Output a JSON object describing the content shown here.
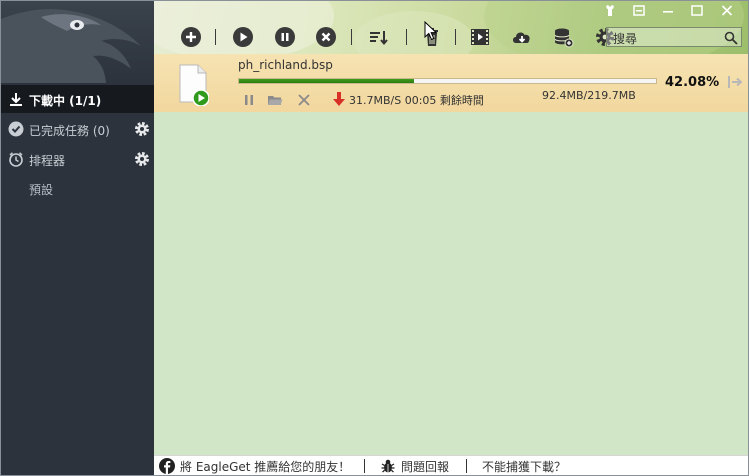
{
  "sidebar": {
    "items": [
      {
        "label": "下載中 (1/1)"
      },
      {
        "label": "已完成任務 (0)"
      },
      {
        "label": "排程器"
      }
    ],
    "sub_item": "預設"
  },
  "toolbar": {
    "search_placeholder": "搜尋"
  },
  "download": {
    "filename": "ph_richland.bsp",
    "progress_percent": "42.08%",
    "progress_fraction": 0.4208,
    "speed_text": "31.7MB/S 00:05 剩餘時間",
    "size_text": "92.4MB/219.7MB"
  },
  "statusbar": {
    "recommend": "將 EagleGet 推薦給您的朋友！",
    "feedback": "問題回報",
    "cannot_capture": "不能捕獲下載？"
  },
  "colors": {
    "sidebar_bg": "#2c333c",
    "content_bg": "#d1e5c7",
    "progress_green": "#2f7d10",
    "speed_arrow_red": "#d93025"
  }
}
